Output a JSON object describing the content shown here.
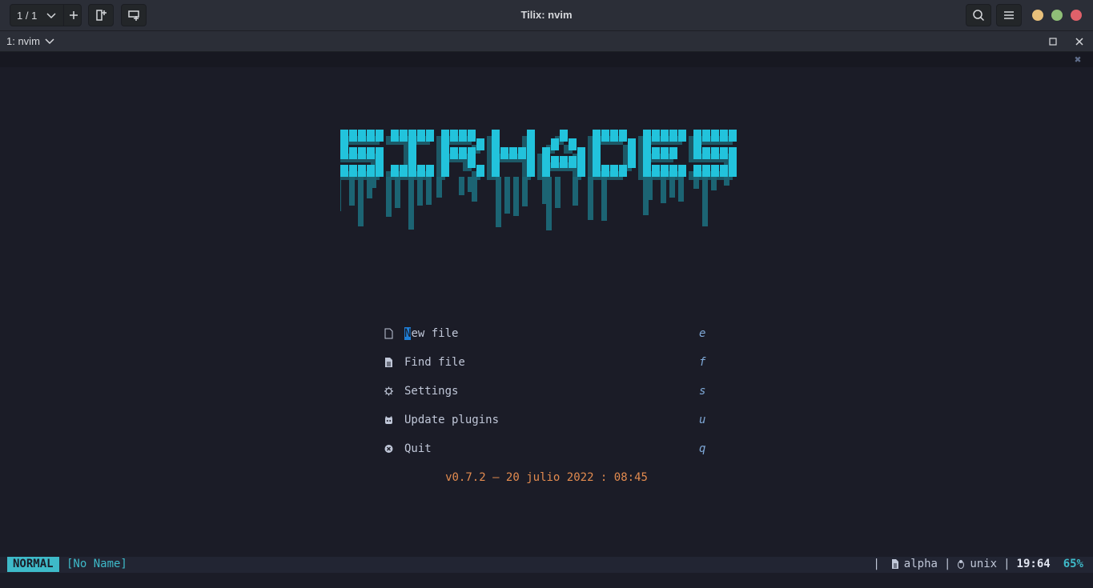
{
  "window": {
    "title": "Tilix: nvim",
    "session_label": "1 / 1",
    "terminal_title": "1: nvim"
  },
  "dashboard": {
    "logo_text": "SIRHADES",
    "menu": [
      {
        "label": "New file",
        "key": "e",
        "icon": "file-icon"
      },
      {
        "label": "Find file",
        "key": "f",
        "icon": "file-text-icon"
      },
      {
        "label": "Settings",
        "key": "s",
        "icon": "gear-icon"
      },
      {
        "label": "Update plugins",
        "key": "u",
        "icon": "github-icon"
      },
      {
        "label": "Quit",
        "key": "q",
        "icon": "close-circle-icon"
      }
    ],
    "footer": "v0.7.2 — 20 julio 2022 : 08:45"
  },
  "statusline": {
    "mode": "NORMAL",
    "buffer": "[No Name]",
    "sep": "|",
    "filetype": "alpha",
    "fileformat": "unix",
    "position": "19:64",
    "percent": "65%"
  },
  "colors": {
    "accent": "#3ebac9",
    "logo_bright": "#22c3dc",
    "logo_dark": "#1c6473",
    "footer": "#e38b4f",
    "background": "#1b1c27"
  }
}
